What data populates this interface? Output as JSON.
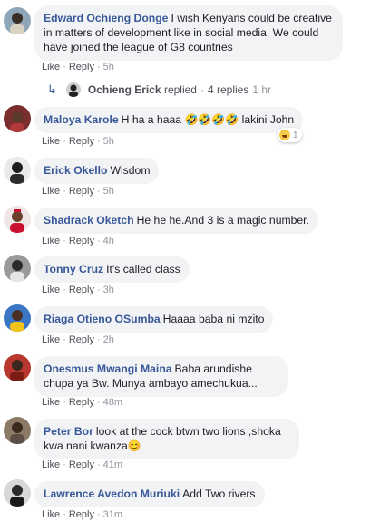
{
  "colors": {
    "author": "#385898",
    "bubble": "#f2f3f5",
    "meta": "#90949c",
    "action": "#4b4f56"
  },
  "actions": {
    "like": "Like",
    "reply": "Reply",
    "separator": "·"
  },
  "comments": [
    {
      "author": "Edward Ochieng Donge",
      "text": "I wish Kenyans could be creative in matters of development like in social media. We could have joined the league of G8 countries",
      "time": "5h",
      "avatar_icon": "person-avatar-icon",
      "replies": {
        "replier": "Ochieng Erick",
        "verb": "replied",
        "count": "4 replies",
        "time": "1 hr"
      }
    },
    {
      "author": "Maloya Karole",
      "text": "H ha a haaa",
      "emoji": "🤣🤣🤣🤣",
      "text_after": "lakini John",
      "time": "5h",
      "avatar_icon": "person-avatar-icon",
      "reactions": {
        "icon": "haha-reaction-icon",
        "count": "1"
      }
    },
    {
      "author": "Erick Okello",
      "text": "Wisdom",
      "time": "5h",
      "avatar_icon": "person-avatar-icon"
    },
    {
      "author": "Shadrack Oketch",
      "text": "He he he.And 3 is a magic number.",
      "time": "4h",
      "avatar_icon": "person-avatar-icon"
    },
    {
      "author": "Tonny Cruz",
      "text": "It's called class",
      "time": "3h",
      "avatar_icon": "person-avatar-icon"
    },
    {
      "author": "Riaga Otieno OSumba",
      "text": "Haaaa baba ni mzito",
      "time": "2h",
      "avatar_icon": "person-avatar-icon"
    },
    {
      "author": "Onesmus Mwangi Maina",
      "text": "Baba arundishe chupa ya Bw. Munya ambayo amechukua...",
      "time": "48m",
      "avatar_icon": "person-avatar-icon"
    },
    {
      "author": "Peter Bor",
      "text": "look at the cock btwn two lions ,shoka kwa nani kwanza",
      "emoji": "😊",
      "time": "41m",
      "avatar_icon": "person-avatar-icon"
    },
    {
      "author": "Lawrence Avedon Muriuki",
      "text": "Add Two rivers",
      "time": "31m",
      "avatar_icon": "person-avatar-icon"
    }
  ]
}
